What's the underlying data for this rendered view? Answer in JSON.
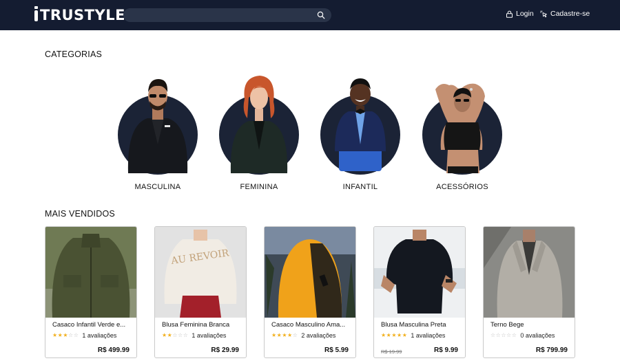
{
  "header": {
    "logo_text": "TRUSTYLE",
    "search_placeholder": "",
    "login_label": "Login",
    "signup_label": "Cadastre-se"
  },
  "colors": {
    "header_bg": "#141c31",
    "circle_bg": "#1b2336",
    "star_on": "#f2b01e",
    "star_off": "#bdbdbd"
  },
  "categories": {
    "title": "CATEGORIAS",
    "items": [
      {
        "label": "MASCULINA"
      },
      {
        "label": "FEMININA"
      },
      {
        "label": "INFANTIL"
      },
      {
        "label": "ACESSÓRIOS"
      }
    ]
  },
  "best_sellers": {
    "title": "MAIS VENDIDOS",
    "products": [
      {
        "name": "Casaco Infantil Verde e...",
        "rating": 3,
        "reviews": "1 avaliações",
        "price": "R$ 499.99",
        "old_price": ""
      },
      {
        "name": "Blusa Feminina Branca",
        "rating": 2,
        "reviews": "1 avaliações",
        "price": "R$ 29.99",
        "old_price": ""
      },
      {
        "name": "Casaco Masculino Ama...",
        "rating": 4,
        "reviews": "2 avaliações",
        "price": "R$ 5.99",
        "old_price": ""
      },
      {
        "name": "Blusa Masculina Preta",
        "rating": 5,
        "reviews": "1 avaliações",
        "price": "R$ 9.99",
        "old_price": "R$ 19.99"
      },
      {
        "name": "Terno Bege",
        "rating": 0,
        "reviews": "0 avaliações",
        "price": "R$ 799.99",
        "old_price": ""
      }
    ]
  }
}
